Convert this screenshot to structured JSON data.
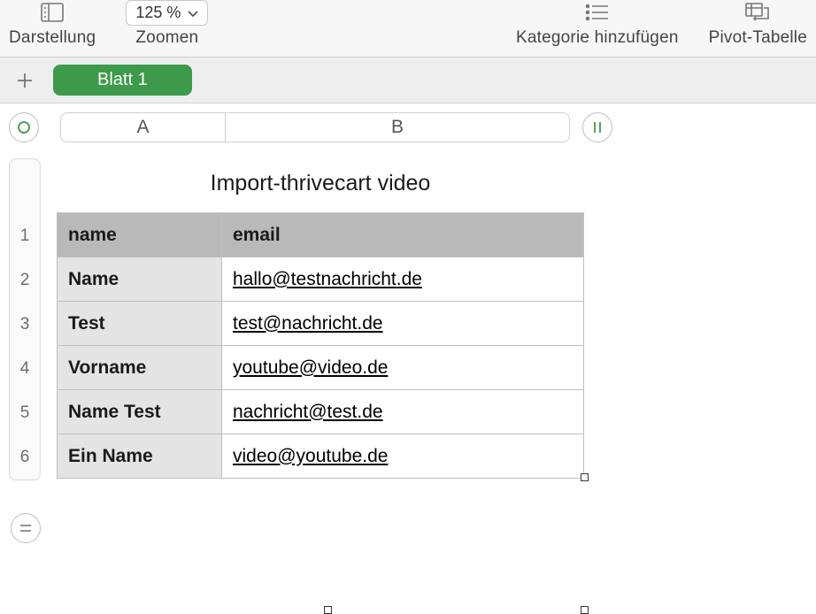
{
  "toolbar": {
    "view_label": "Darstellung",
    "zoom_label": "Zoomen",
    "zoom_value": "125 %",
    "add_category_label": "Kategorie hinzufügen",
    "pivot_label": "Pivot-Tabelle"
  },
  "tabs": {
    "sheet1": "Blatt 1"
  },
  "columns": {
    "a": "A",
    "b": "B"
  },
  "rows": {
    "r1": "1",
    "r2": "2",
    "r3": "3",
    "r4": "4",
    "r5": "5",
    "r6": "6"
  },
  "table": {
    "title": "Import-thrivecart video",
    "header_name": "name",
    "header_email": "email",
    "data": [
      {
        "name": "Name",
        "email": "hallo@testnachricht.de"
      },
      {
        "name": "Test",
        "email": "test@nachricht.de"
      },
      {
        "name": "Vorname",
        "email": "youtube@video.de"
      },
      {
        "name": "Name Test",
        "email": "nachricht@test.de"
      },
      {
        "name": "Ein Name",
        "email": "video@youtube.de"
      }
    ]
  }
}
